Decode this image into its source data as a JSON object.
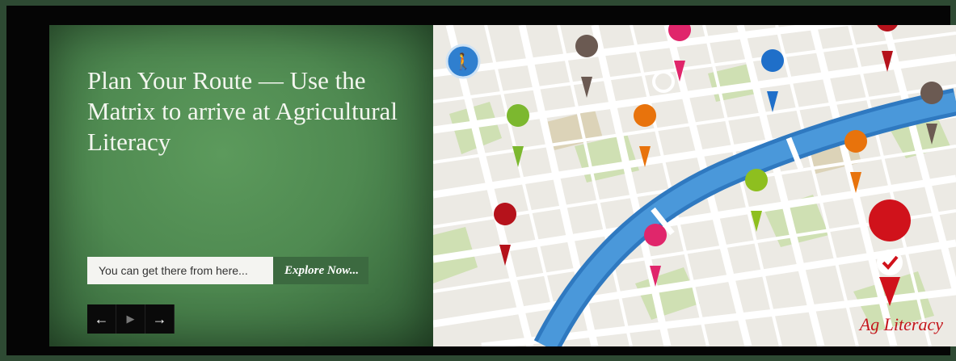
{
  "hero": {
    "headline": "Plan Your Route — Use the Matrix to arrive at Agricultural Literacy",
    "cta_text": "You can get there from here...",
    "cta_link": "Explore Now...",
    "map_label": "Ag Literacy"
  },
  "controls": {
    "prev_icon": "←",
    "play_icon": "▶",
    "next_icon": "→"
  },
  "pins": [
    {
      "name": "pedestrian-icon",
      "color": "#3a8fd6"
    },
    {
      "name": "geometry-icon",
      "color": "#6b5a52"
    },
    {
      "name": "apple-icon",
      "color": "#e0266b"
    },
    {
      "name": "flask-icon",
      "color": "#1f6fc9"
    },
    {
      "name": "gear-icon",
      "color": "#b5121b"
    },
    {
      "name": "globe-icon",
      "color": "#6b5a52"
    },
    {
      "name": "weather-icon",
      "color": "#7cb82f"
    },
    {
      "name": "museum-icon",
      "color": "#e8730c"
    },
    {
      "name": "satellite-icon",
      "color": "#e8730c"
    },
    {
      "name": "heart-icon",
      "color": "#8ebf1f"
    },
    {
      "name": "grade-icon",
      "color": "#b5121b"
    },
    {
      "name": "trend-icon",
      "color": "#e0266b"
    },
    {
      "name": "checkmark-icon",
      "color": "#d0121b"
    }
  ]
}
